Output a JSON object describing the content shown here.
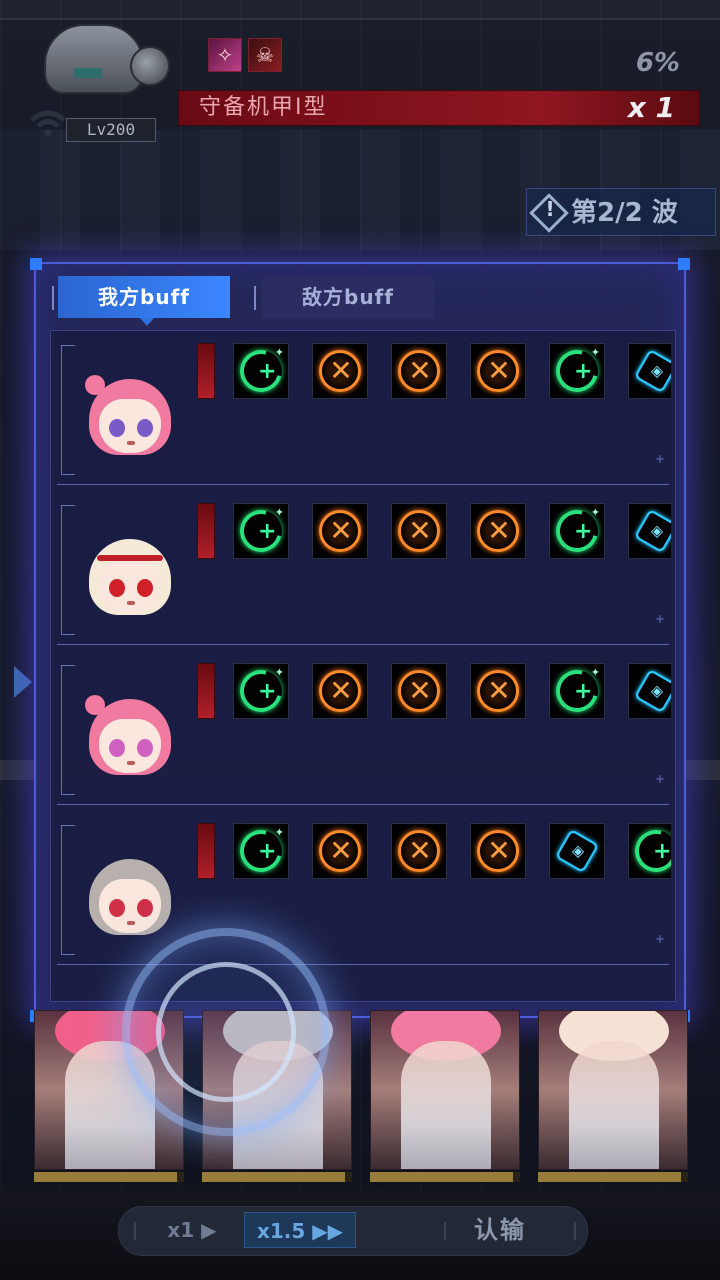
{
  "enemy": {
    "name": "守备机甲I型",
    "level": "Lv200",
    "hp_percent": "6%",
    "multiplier": "x 1",
    "skill_icons": [
      "pink-skill-icon",
      "skull-debuff-icon"
    ]
  },
  "wave": {
    "label": "第2/2 波"
  },
  "panel": {
    "tabs": [
      {
        "label": "我方buff",
        "active": true
      },
      {
        "label": "敌方buff",
        "active": false
      }
    ],
    "rows": [
      {
        "character": "pink-hair-girl",
        "hair": "#f07aa0",
        "eye": "#7a5ac8",
        "buffs": [
          "debuff",
          "heal",
          "atk",
          "atk",
          "atk",
          "heal",
          "shield"
        ]
      },
      {
        "character": "blonde-hairband-girl",
        "hair": "#f5ead8",
        "eye": "#d0202a",
        "buffs": [
          "debuff",
          "heal",
          "atk",
          "atk",
          "atk",
          "heal",
          "shield"
        ]
      },
      {
        "character": "pink-bun-girl",
        "hair": "#f07aa0",
        "eye": "#d060c0",
        "buffs": [
          "debuff",
          "heal",
          "atk",
          "atk",
          "atk",
          "heal",
          "shield"
        ]
      },
      {
        "character": "silver-hair-girl",
        "hair": "#b8b0ac",
        "eye": "#d03048",
        "buffs": [
          "debuff",
          "heal",
          "atk",
          "atk",
          "atk",
          "shield",
          "heal"
        ]
      }
    ]
  },
  "cards": [
    {
      "hair": "#f0608a",
      "hp": 0.95
    },
    {
      "hair": "#c8c0c0",
      "hp": 0.95
    },
    {
      "hair": "#f07aa0",
      "hp": 0.95
    },
    {
      "hair": "#f5e2d4",
      "hp": 0.95
    }
  ],
  "controls": {
    "speed_1": "x1 ▶",
    "speed_15": "x1.5 ▶▶",
    "surrender": "认输"
  },
  "colors": {
    "panel_border": "#4e5bd8",
    "tab_active": "#3b86ff",
    "heal": "#29e07a",
    "attack": "#ff8a2a",
    "shield": "#2ac4ff",
    "hp_bar": "#8f1620"
  }
}
